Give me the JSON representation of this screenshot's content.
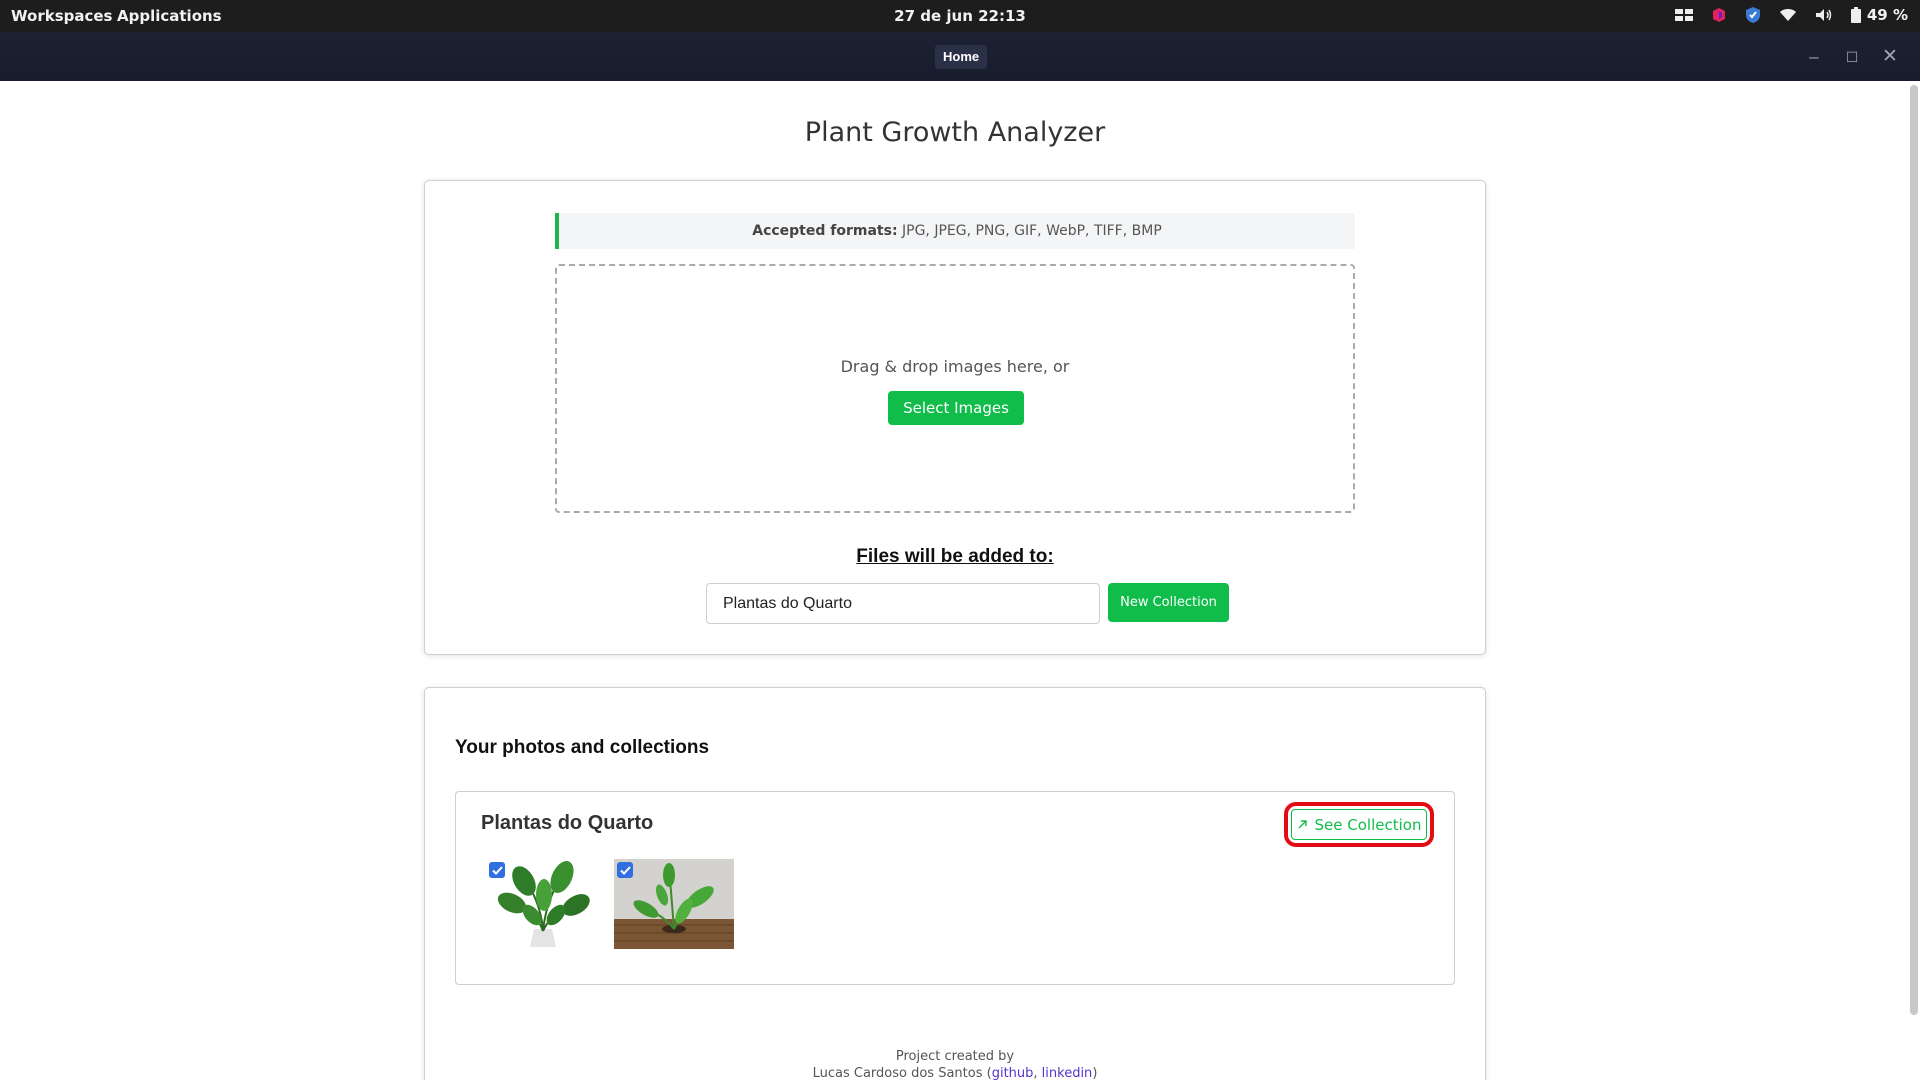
{
  "system_bar": {
    "workspaces": "Workspaces",
    "applications": "Applications",
    "clock": "27 de jun  22:13",
    "battery": "49 %"
  },
  "window": {
    "title": "Home"
  },
  "app": {
    "title": "Plant Growth Analyzer"
  },
  "upload": {
    "formats_label": "Accepted formats:",
    "formats_list": " JPG, JPEG, PNG, GIF, WebP, TIFF, BMP",
    "drop_hint": "Drag & drop images here, or",
    "select_button": "Select Images",
    "added_to_label": "Files will be added to:",
    "collection_value": "Plantas do Quarto",
    "new_collection_button": "New Collection"
  },
  "collections": {
    "heading": "Your photos and collections",
    "items": [
      {
        "name": "Plantas do Quarto",
        "see_button": "See Collection",
        "photos": [
          {
            "checked": true,
            "subject": "potted plant on white background"
          },
          {
            "checked": true,
            "subject": "plant on wooden table"
          }
        ]
      }
    ]
  },
  "footer": {
    "line1": "Project created by",
    "author": "Lucas Cardoso dos Santos (",
    "github": "github",
    "sep": ", ",
    "linkedin": "linkedin",
    "close": ")"
  },
  "colors": {
    "accent_green": "#11bd4a",
    "highlight_red": "#e20d12",
    "checkbox_blue": "#2f6fe0"
  }
}
